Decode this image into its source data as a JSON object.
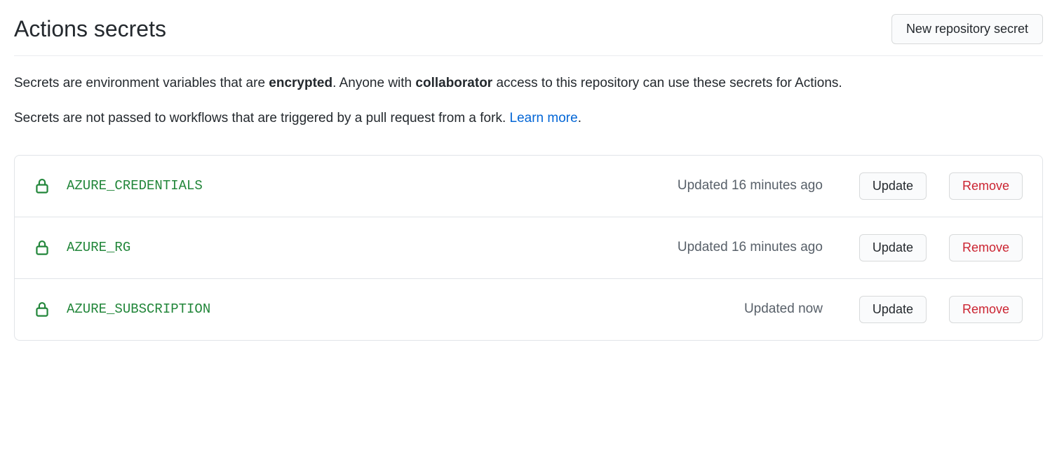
{
  "header": {
    "title": "Actions secrets",
    "new_secret_button": "New repository secret"
  },
  "description": {
    "p1_part1": "Secrets are environment variables that are ",
    "p1_bold1": "encrypted",
    "p1_part2": ". Anyone with ",
    "p1_bold2": "collaborator",
    "p1_part3": " access to this repository can use these secrets for Actions.",
    "p2_part1": "Secrets are not passed to workflows that are triggered by a pull request from a fork. ",
    "p2_link": "Learn more",
    "p2_part2": "."
  },
  "buttons": {
    "update": "Update",
    "remove": "Remove"
  },
  "secrets": [
    {
      "name": "AZURE_CREDENTIALS",
      "updated": "Updated 16 minutes ago"
    },
    {
      "name": "AZURE_RG",
      "updated": "Updated 16 minutes ago"
    },
    {
      "name": "AZURE_SUBSCRIPTION",
      "updated": "Updated now"
    }
  ]
}
